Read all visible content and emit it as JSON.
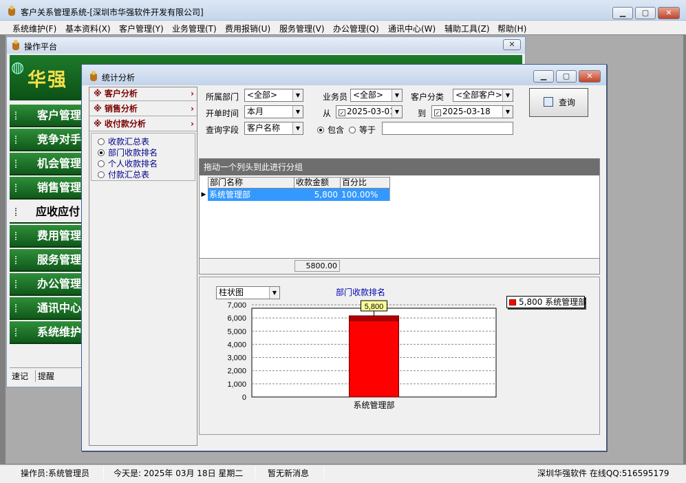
{
  "app": {
    "title": "客户关系管理系统-[深圳市华强软件开发有限公司]"
  },
  "menu": [
    "系统维护(F)",
    "基本资料(X)",
    "客户管理(Y)",
    "业务管理(T)",
    "费用报销(U)",
    "服务管理(V)",
    "办公管理(Q)",
    "通讯中心(W)",
    "辅助工具(Z)",
    "帮助(H)"
  ],
  "ops": {
    "title": "操作平台",
    "logo": "华强",
    "nav": [
      "客户管理",
      "竞争对手",
      "机会管理",
      "销售管理",
      "应收应付",
      "费用管理",
      "服务管理",
      "办公管理",
      "通讯中心",
      "系统维护"
    ],
    "active_nav": 4,
    "tabs": [
      "速记",
      "提醒"
    ]
  },
  "stats": {
    "title": "统计分析",
    "categories": [
      "客户分析",
      "销售分析",
      "收付款分析"
    ],
    "reports": [
      "收款汇总表",
      "部门收款排名",
      "个人收款排名",
      "付款汇总表"
    ],
    "selected_report": 1,
    "filters": {
      "dept_label": "所属部门",
      "dept_value": "<全部>",
      "salesman_label": "业务员",
      "salesman_value": "<全部>",
      "custcat_label": "客户分类",
      "custcat_value": "<全部客户>",
      "time_label": "开单时间",
      "time_value": "本月",
      "from_label": "从",
      "from_value": "2025-03-01",
      "to_label": "到",
      "to_value": "2025-03-18",
      "field_label": "查询字段",
      "field_value": "客户名称",
      "contains_label": "包含",
      "equals_label": "等于",
      "search_value": ""
    },
    "query_button": "查询",
    "grid": {
      "group_hint": "拖动一个列头到此进行分组",
      "columns": [
        "部门名称",
        "收款金额",
        "百分比"
      ],
      "rows": [
        [
          "系统管理部",
          "5,800",
          "100.00%"
        ]
      ],
      "total": "5800.00"
    },
    "chart_type": "柱状图"
  },
  "chart_data": {
    "type": "bar",
    "title": "部门收款排名",
    "categories": [
      "系统管理部"
    ],
    "series": [
      {
        "name": "系统管理部",
        "values": [
          5800
        ]
      }
    ],
    "data_labels": [
      "5,800"
    ],
    "legend_label": "5,800 系统管理部",
    "ylim": [
      0,
      7000
    ],
    "yticks": [
      "0",
      "1,000",
      "2,000",
      "3,000",
      "4,000",
      "5,000",
      "6,000",
      "7,000"
    ],
    "grid": true,
    "legend_position": "top-right",
    "colors": {
      "bar": "#ff0000",
      "bar_top": "#b00000"
    }
  },
  "status": {
    "operator": "操作员:系统管理员",
    "today": "今天是: 2025年 03月 18日  星期二",
    "messages": "暂无新消息",
    "company": "深圳华强软件 在线QQ:516595179"
  }
}
